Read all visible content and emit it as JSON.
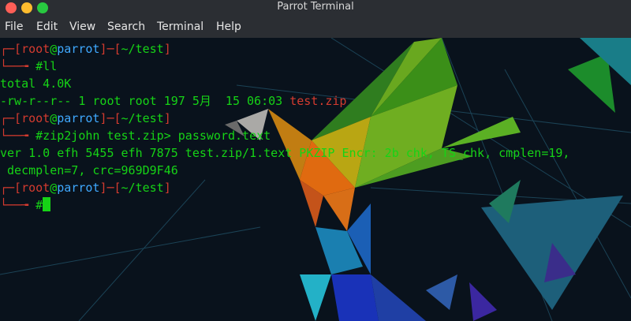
{
  "window": {
    "title": "Parrot Terminal"
  },
  "menu": [
    "File",
    "Edit",
    "View",
    "Search",
    "Terminal",
    "Help"
  ],
  "prompt": {
    "user": "root",
    "host": "parrot",
    "path": "~/test"
  },
  "lines": {
    "cmd1": "#ll",
    "out1": "total 4.0K",
    "out2_perm": "-rw-r--r-- 1 root root 197 5月  15 06:03 ",
    "out2_file": "test.zip",
    "cmd2": "#zip2john test.zip> password.text",
    "out3": "ver 1.0 efh 5455 efh 7875 test.zip/1.text PKZIP Encr: 2b chk, TS_chk, cmplen=19,",
    "out4": " decmplen=7, crc=969D9F46",
    "cmd3": "#"
  },
  "colors": {
    "prompt_red": "#d43b2f",
    "host_blue": "#3fa9ff",
    "text_green": "#16d316"
  }
}
